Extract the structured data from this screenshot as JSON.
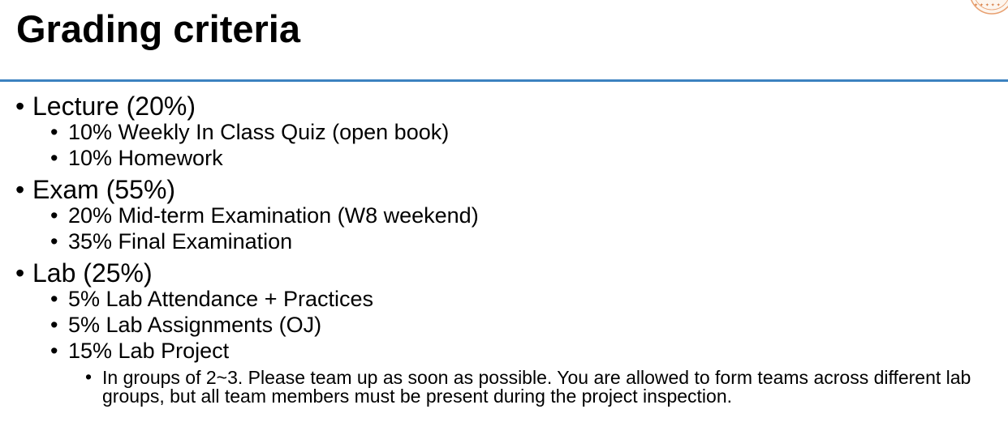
{
  "slide": {
    "title": "Grading criteria",
    "accent_color": "#3c82c0",
    "logo_icon": "university-seal-icon"
  },
  "bullet_char": "•",
  "sections": [
    {
      "label": "Lecture (20%)",
      "items": [
        {
          "text": "10% Weekly In Class Quiz (open book)"
        },
        {
          "text": "10% Homework"
        }
      ]
    },
    {
      "label": "Exam (55%)",
      "items": [
        {
          "text": "20% Mid-term Examination (W8 weekend)"
        },
        {
          "text": "35% Final Examination"
        }
      ]
    },
    {
      "label": "Lab (25%)",
      "items": [
        {
          "text": "5% Lab Attendance + Practices"
        },
        {
          "text": "5% Lab Assignments (OJ)"
        },
        {
          "text": "15% Lab Project"
        }
      ],
      "note": "In groups of 2~3. Please team up as soon as possible. You are allowed to form teams across different lab groups, but all team members must be present during the project inspection."
    }
  ]
}
